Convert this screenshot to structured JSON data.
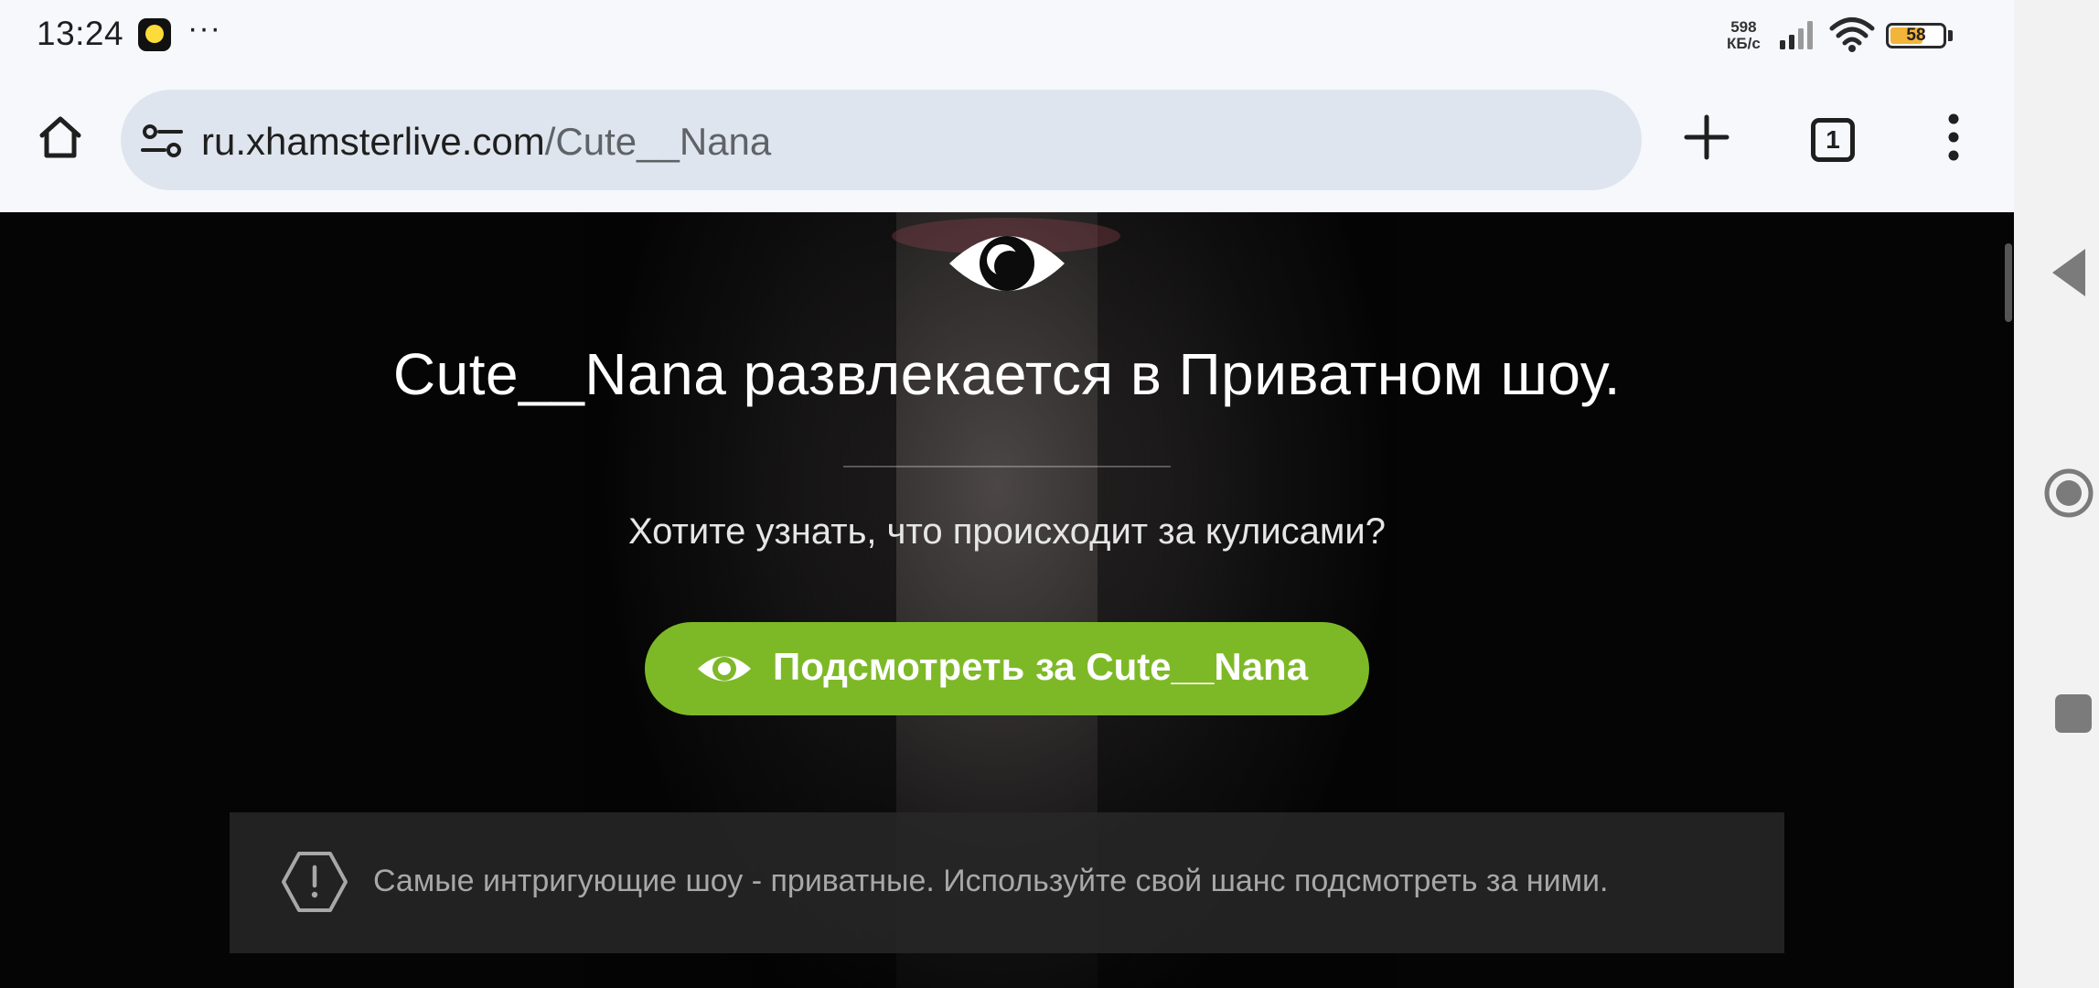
{
  "status_bar": {
    "time": "13:24",
    "more": "···",
    "net_speed_value": "598",
    "net_speed_unit": "КБ/с",
    "battery_level": "58",
    "battery_fraction": 0.58,
    "battery_color": "#f3b43a",
    "icons": [
      "notification-app-icon",
      "signal-icon",
      "wifi-icon",
      "battery-icon"
    ]
  },
  "browser": {
    "url_host": "ru.xhamsterlive.com",
    "url_path": "/Cute__Nana",
    "tab_count": "1",
    "icons": [
      "home-icon",
      "tune-icon",
      "plus-icon",
      "more-vert-icon"
    ]
  },
  "page": {
    "headline": "Cute__Nana развлекается в Приватном шоу.",
    "subline": "Хотите узнать, что происходит за кулисами?",
    "cta_label": "Подсмотреть за Cute__Nana",
    "cta_color": "#7db927",
    "notice_text": "Самые интригующие шоу - приватные. Используйте свой шанс подсмотреть за ними."
  },
  "nav_bar": {
    "icons": [
      "back-icon",
      "home-circle-icon",
      "recents-icon"
    ]
  }
}
